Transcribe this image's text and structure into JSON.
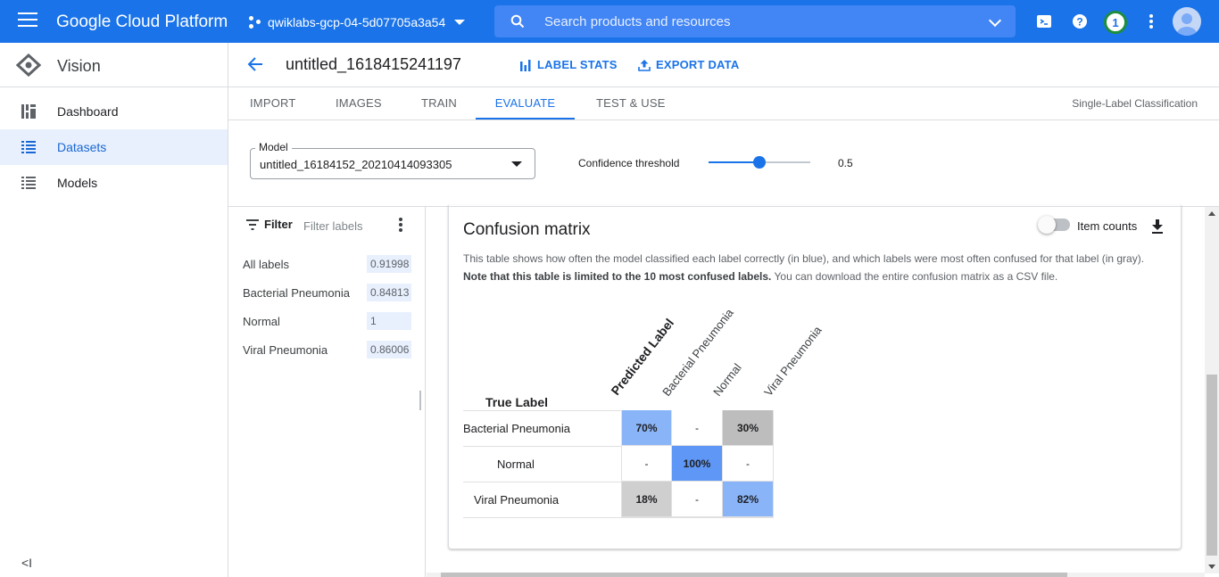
{
  "topbar": {
    "brand": "Google Cloud Platform",
    "project": "qwiklabs-gcp-04-5d07705a3a54",
    "search_placeholder": "Search products and resources",
    "notification_count": "1",
    "bg_color": "#1a73e8"
  },
  "leftnav": {
    "product": "Vision",
    "items": [
      {
        "label": "Dashboard",
        "icon": "dashboard-icon"
      },
      {
        "label": "Datasets",
        "icon": "list-icon",
        "active": true
      },
      {
        "label": "Models",
        "icon": "list-icon"
      }
    ],
    "collapse_icon": "collapse-icon",
    "collapse": "<I"
  },
  "header": {
    "dataset_title": "untitled_1618415241197",
    "label_stats": "LABEL STATS",
    "export_data": "EXPORT DATA"
  },
  "tabs": {
    "items": [
      "IMPORT",
      "IMAGES",
      "TRAIN",
      "EVALUATE",
      "TEST & USE"
    ],
    "active": "EVALUATE",
    "classification": "Single-Label Classification"
  },
  "model": {
    "label": "Model",
    "value": "untitled_16184152_20210414093305",
    "confidence_label": "Confidence threshold",
    "confidence_value": "0.5",
    "confidence": 0.5
  },
  "filter": {
    "button": "Filter",
    "placeholder": "Filter labels",
    "labels": [
      {
        "name": "All labels",
        "score": "0.91998"
      },
      {
        "name": "Bacterial Pneumonia",
        "score": "0.84813"
      },
      {
        "name": "Normal",
        "score": "1"
      },
      {
        "name": "Viral Pneumonia",
        "score": "0.86006"
      }
    ]
  },
  "confusion": {
    "title": "Confusion matrix",
    "item_counts": "Item counts",
    "desc1": "This table shows how often the model classified each label correctly (in blue), and which labels were most often confused for that label (in gray).",
    "desc2_bold": "Note that this table is limited to the 10 most confused labels.",
    "desc2_rest": " You can download the entire confusion matrix as a CSV file.",
    "true_label": "True Label",
    "predicted_label": "Predicted Label",
    "columns": [
      "Bacterial Pneumonia",
      "Normal",
      "Viral Pneumonia"
    ],
    "rows": [
      {
        "label": "Bacterial Pneumonia",
        "cells": [
          "70%",
          "-",
          "30%"
        ]
      },
      {
        "label": "Normal",
        "cells": [
          "-",
          "100%",
          "-"
        ]
      },
      {
        "label": "Viral Pneumonia",
        "cells": [
          "18%",
          "-",
          "82%"
        ]
      }
    ],
    "colors": {
      "correct_strong": "#5e97f6",
      "correct_light": "#8ab4f8",
      "confused": "#bdbdbd",
      "confused_light": "#cfcfcf"
    }
  }
}
